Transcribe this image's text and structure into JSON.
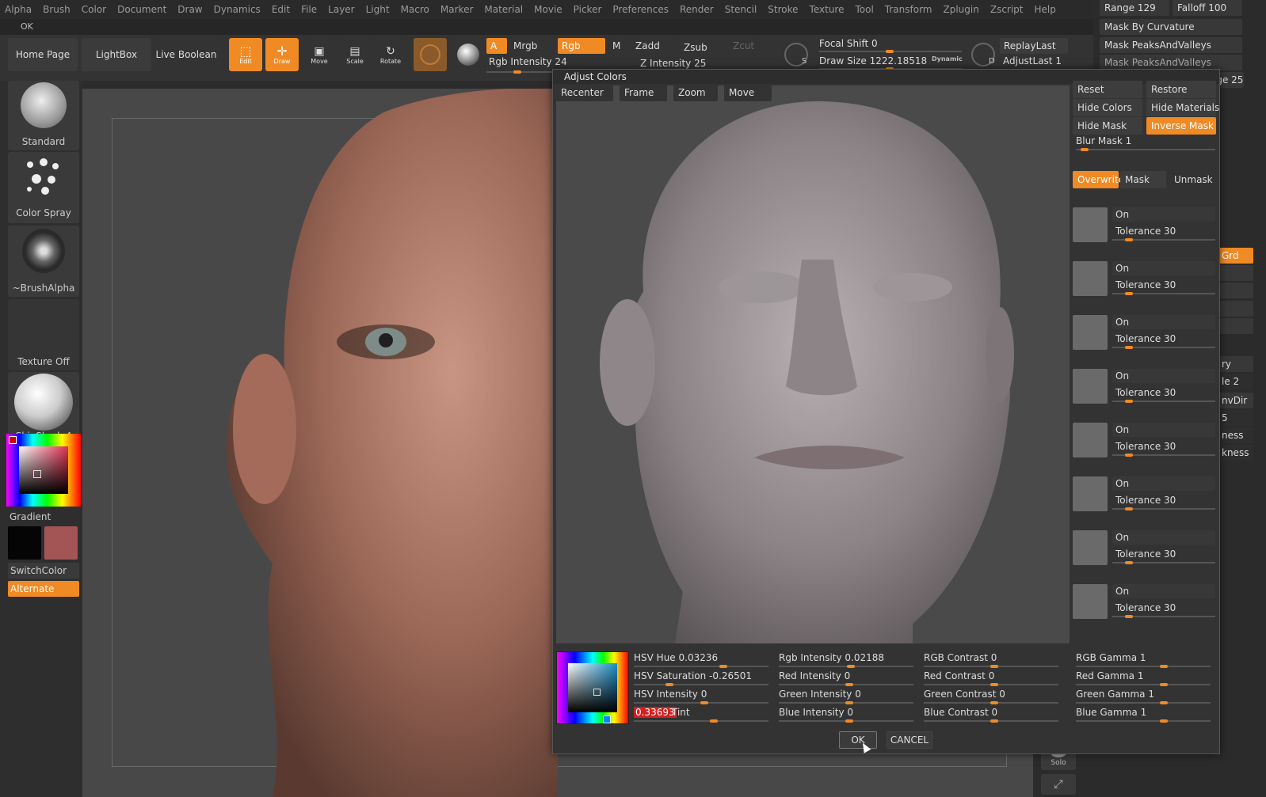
{
  "menu": [
    "Alpha",
    "Brush",
    "Color",
    "Document",
    "Draw",
    "Dynamics",
    "Edit",
    "File",
    "Layer",
    "Light",
    "Macro",
    "Marker",
    "Material",
    "Movie",
    "Picker",
    "Preferences",
    "Render",
    "Stencil",
    "Stroke",
    "Texture",
    "Tool",
    "Transform",
    "Zplugin",
    "Zscript",
    "Help"
  ],
  "okbar": {
    "ok": "OK"
  },
  "toolbar": {
    "home_page": "Home Page",
    "lightbox": "LightBox",
    "live_boolean": "Live Boolean",
    "edit": "Edit",
    "draw": "Draw",
    "move": "Move",
    "scale": "Scale",
    "rotate": "Rotate",
    "a": "A",
    "mrgb": "Mrgb",
    "rgb": "Rgb",
    "m": "M",
    "zadd": "Zadd",
    "zsub": "Zsub",
    "zcut": "Zcut",
    "rgb_intensity": "Rgb Intensity 24",
    "z_intensity": "Z Intensity 25",
    "focal_shift": "Focal Shift 0",
    "draw_size": "Draw Size 1222.18518",
    "dynamic": "Dynamic",
    "replay_last": "ReplayLast",
    "adjust_last": "AdjustLast 1",
    "s_label": "S",
    "d_label": "D"
  },
  "shelf": {
    "standard": "Standard",
    "color_spray": "Color Spray",
    "brush_alpha": "~BrushAlpha",
    "texture_off": "Texture Off",
    "skin_shade": "SkinShade4",
    "gradient": "Gradient",
    "switch_color": "SwitchColor",
    "alternate": "Alternate"
  },
  "rpanel": {
    "range": "Range 129",
    "falloff": "Falloff 100",
    "mask_by_curvature": "Mask By Curvature",
    "mask_peaks_1": "Mask PeaksAndValleys",
    "mask_peaks_2": "Mask PeaksAndValleys",
    "range_25": "ige 25",
    "stubs": [
      "Grd",
      "",
      "",
      "",
      "ry",
      "le 2",
      "nvDir",
      "5",
      "ness",
      "kness"
    ]
  },
  "dialog": {
    "title": "Adjust Colors",
    "nav": [
      "Recenter",
      "Frame",
      "Zoom",
      "Move"
    ],
    "reset": "Reset",
    "restore": "Restore",
    "hide_colors": "Hide Colors",
    "hide_materials": "Hide Materials",
    "hide_mask": "Hide Mask",
    "inverse_mask": "Inverse Mask",
    "blur_mask": "Blur Mask 1",
    "overwrite": "Overwrite",
    "mask": "Mask",
    "unmask": "Unmask",
    "slot_on": "On",
    "slot_tolerance": "Tolerance 30",
    "params": {
      "hsv_hue": "HSV Hue 0.03236",
      "hsv_saturation": "HSV Saturation -0.26501",
      "hsv_intensity": "HSV Intensity 0",
      "tint_value": "0.33693",
      "tint_label": "Tint",
      "rgb_intensity": "Rgb Intensity 0.02188",
      "red_intensity": "Red Intensity 0",
      "green_intensity": "Green Intensity 0",
      "blue_intensity": "Blue Intensity 0",
      "rgb_contrast": "RGB Contrast 0",
      "red_contrast": "Red Contrast 0",
      "green_contrast": "Green Contrast 0",
      "blue_contrast": "Blue Contrast 0",
      "rgb_gamma": "RGB Gamma 1",
      "red_gamma": "Red Gamma 1",
      "green_gamma": "Green Gamma 1",
      "blue_gamma": "Blue Gamma 1"
    },
    "ok": "OK",
    "cancel": "CANCEL"
  },
  "solo": "Solo",
  "colors": {
    "accent": "#f08a24",
    "tint_bg": "#d02020"
  }
}
